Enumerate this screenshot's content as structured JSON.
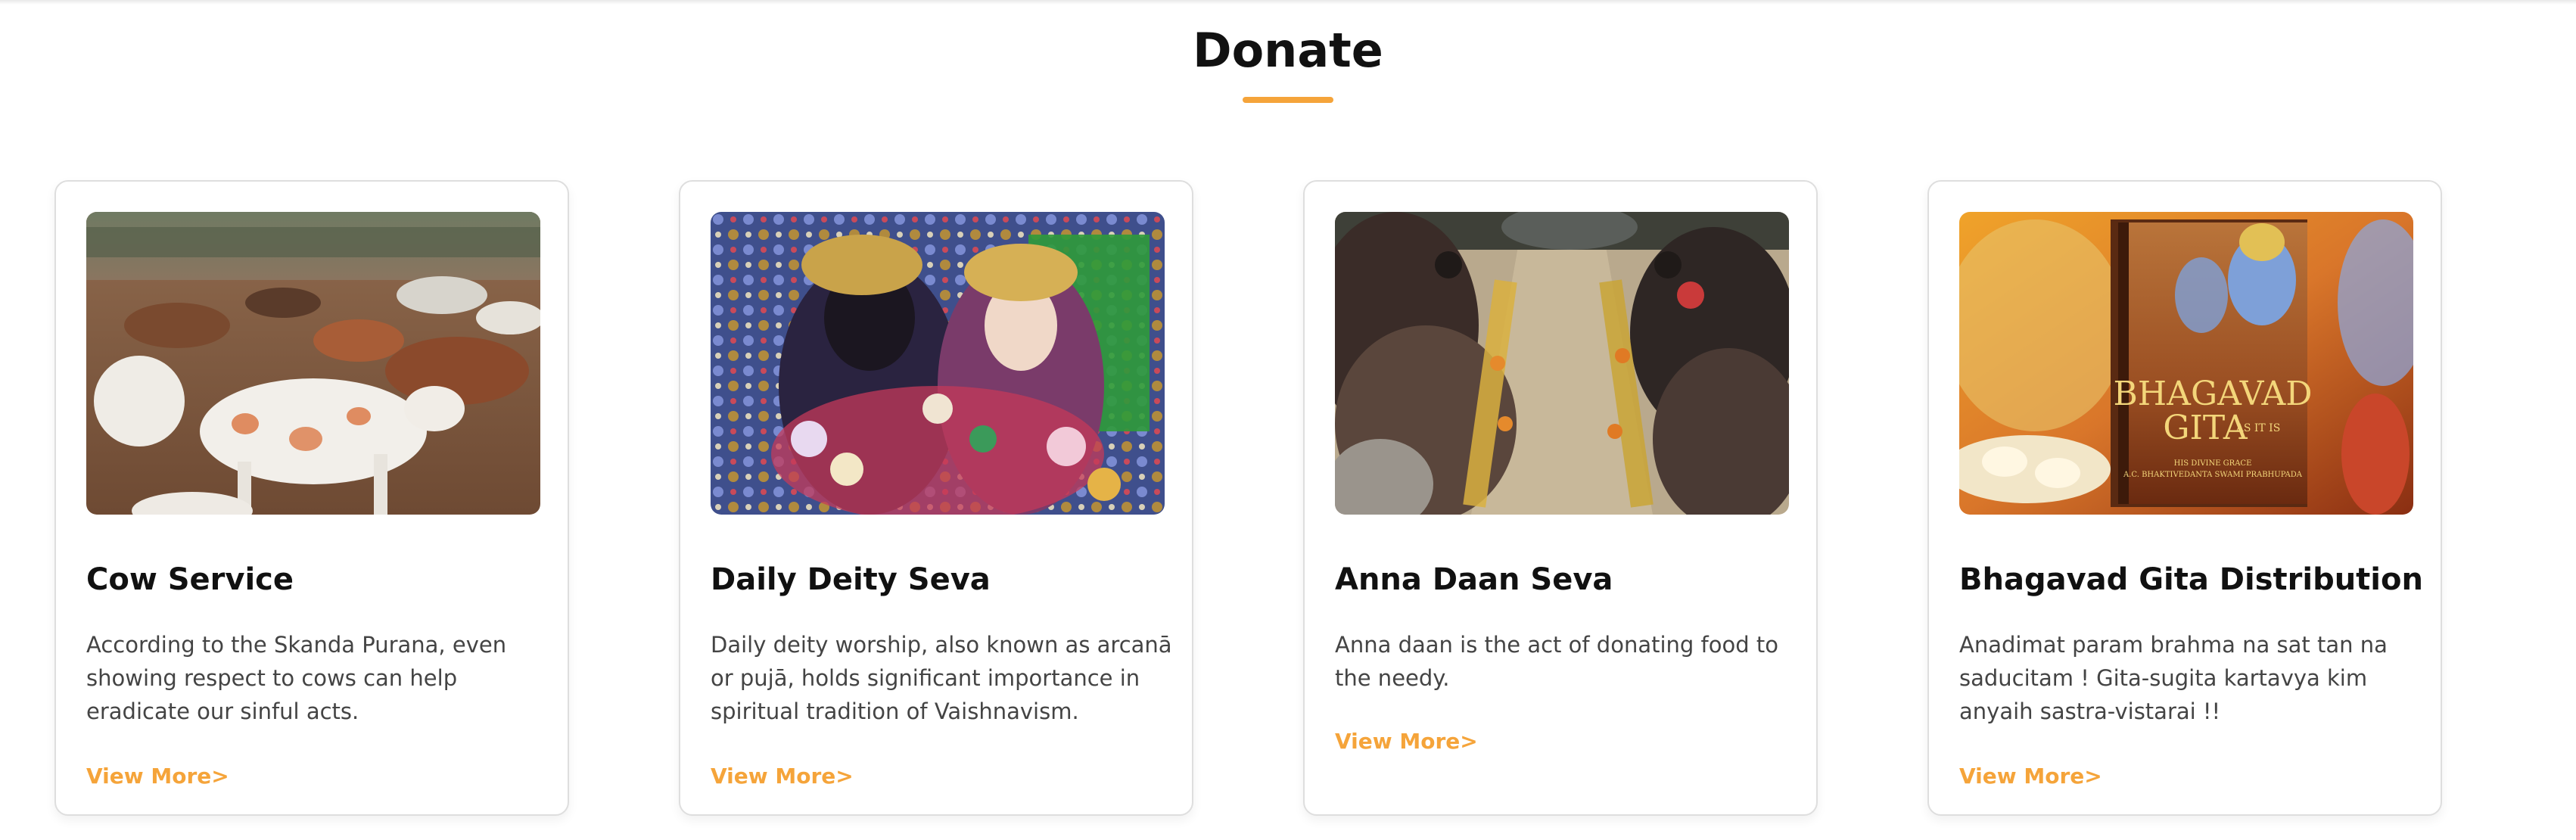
{
  "section": {
    "title": "Donate",
    "accent_color": "#f5a43a"
  },
  "cards": [
    {
      "title": "Cow Service",
      "description": "According to the Skanda Purana, even showing respect to cows can help eradicate our sinful acts.",
      "link": "View More>",
      "image": "cows-in-field-photo"
    },
    {
      "title": "Daily Deity Seva",
      "description": "Daily deity worship, also known as arcanā or pujā, holds significant importance in spiritual tradition of Vaishnavism.",
      "link": "View More>",
      "image": "radha-krishna-deities-photo"
    },
    {
      "title": "Anna Daan Seva",
      "description": "Anna daan is the act of donating food to the needy.",
      "link": "View More>",
      "image": "food-distribution-photo"
    },
    {
      "title": "Bhagavad Gita Distribution",
      "description": "Anadimat param brahma na sat tan na saducitam ! Gita-sugita kartavya kim anyaih sastra-vistarai !!",
      "link": "View More>",
      "image": "bhagavad-gita-book-cover",
      "book_cover": {
        "title_line1": "BHAGAVAD",
        "title_line2": "GITA",
        "subtitle": "AS IT IS",
        "author_line1": "HIS DIVINE GRACE",
        "author_line2": "A.C. BHAKTIVEDANTA SWAMI PRABHUPADA"
      }
    }
  ]
}
